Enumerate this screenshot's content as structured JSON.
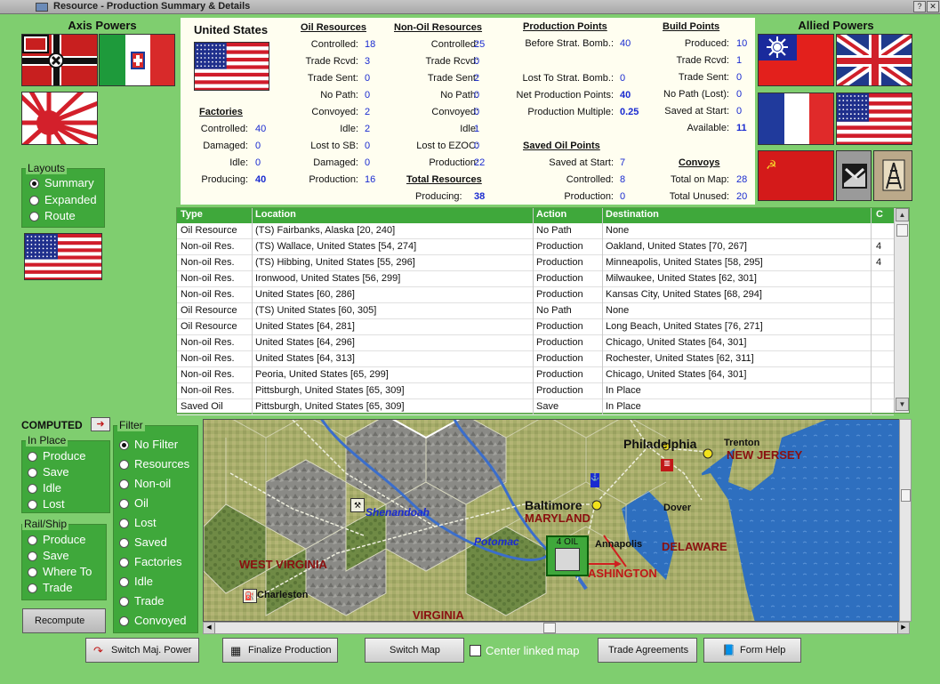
{
  "window": {
    "title": "Resource - Production Summary & Details"
  },
  "axis": {
    "title": "Axis Powers"
  },
  "allied": {
    "title": "Allied Powers"
  },
  "layouts": {
    "label": "Layouts",
    "options": [
      "Summary",
      "Expanded",
      "Route"
    ],
    "selected": "Summary"
  },
  "summary": {
    "country": "United States",
    "factories": {
      "heading": "Factories",
      "rows": [
        {
          "label": "Controlled:",
          "value": "40"
        },
        {
          "label": "Damaged:",
          "value": "0"
        },
        {
          "label": "Idle:",
          "value": "0"
        },
        {
          "label": "Producing:",
          "value": "40"
        }
      ]
    },
    "oil": {
      "heading": "Oil Resources",
      "rows": [
        {
          "label": "Controlled:",
          "value": "18"
        },
        {
          "label": "Trade Rcvd:",
          "value": "3"
        },
        {
          "label": "Trade Sent:",
          "value": "0"
        },
        {
          "label": "No Path:",
          "value": "0"
        },
        {
          "label": "Convoyed:",
          "value": "2"
        },
        {
          "label": "Idle:",
          "value": "2"
        },
        {
          "label": "Lost to SB:",
          "value": "0"
        },
        {
          "label": "Damaged:",
          "value": "0"
        },
        {
          "label": "Production:",
          "value": "16"
        }
      ]
    },
    "nonoil": {
      "heading": "Non-Oil Resources",
      "rows": [
        {
          "label": "Controlled:",
          "value": "25"
        },
        {
          "label": "Trade Rcvd:",
          "value": "0"
        },
        {
          "label": "Trade Sent:",
          "value": "2"
        },
        {
          "label": "No Path:",
          "value": "0"
        },
        {
          "label": "Convoyed:",
          "value": "0"
        },
        {
          "label": "Idle:",
          "value": "1"
        },
        {
          "label": "Lost to EZOC:",
          "value": "0"
        },
        {
          "label": "Production:",
          "value": "22"
        }
      ]
    },
    "total": {
      "heading": "Total Resources",
      "label": "Producing:",
      "value": "38"
    },
    "pp": {
      "heading": "Production Points",
      "rows": [
        {
          "label": "Before Strat. Bomb.:",
          "value": "40"
        },
        {
          "label": "Lost To Strat. Bomb.:",
          "value": "0"
        },
        {
          "label": "Net Production Points:",
          "value": "40"
        },
        {
          "label": "Production Multiple:",
          "value": "0.25"
        }
      ]
    },
    "saved_oil": {
      "heading": "Saved Oil Points",
      "rows": [
        {
          "label": "Saved at Start:",
          "value": "7"
        },
        {
          "label": "Controlled:",
          "value": "8"
        },
        {
          "label": "Production:",
          "value": "0"
        }
      ]
    },
    "bp": {
      "heading": "Build Points",
      "rows": [
        {
          "label": "Produced:",
          "value": "10"
        },
        {
          "label": "Trade Rcvd:",
          "value": "1"
        },
        {
          "label": "Trade Sent:",
          "value": "0"
        },
        {
          "label": "No Path (Lost):",
          "value": "0"
        },
        {
          "label": "Saved at Start:",
          "value": "0"
        },
        {
          "label": "Available:",
          "value": "11"
        }
      ]
    },
    "convoys": {
      "heading": "Convoys",
      "rows": [
        {
          "label": "Total on Map:",
          "value": "28"
        },
        {
          "label": "Total Unused:",
          "value": "20"
        }
      ]
    }
  },
  "table": {
    "headers": [
      "Type",
      "Location",
      "Action",
      "Destination",
      "C"
    ],
    "rows": [
      [
        "Oil Resource",
        "(TS) Fairbanks, Alaska [20, 240]",
        "No Path",
        "None",
        ""
      ],
      [
        "Non-oil Res.",
        "(TS) Wallace, United States [54, 274]",
        "Production",
        "Oakland, United States [70, 267]",
        "4"
      ],
      [
        "Non-oil Res.",
        "(TS) Hibbing, United States [55, 296]",
        "Production",
        "Minneapolis, United States [58, 295]",
        "4"
      ],
      [
        "Non-oil Res.",
        "Ironwood, United States [56, 299]",
        "Production",
        "Milwaukee, United States [62, 301]",
        ""
      ],
      [
        "Non-oil Res.",
        "United States [60, 286]",
        "Production",
        "Kansas City, United States [68, 294]",
        ""
      ],
      [
        "Oil Resource",
        "(TS) United States [60, 305]",
        "No Path",
        "None",
        ""
      ],
      [
        "Oil Resource",
        "United States [64, 281]",
        "Production",
        "Long Beach, United States [76, 271]",
        ""
      ],
      [
        "Non-oil Res.",
        "United States [64, 296]",
        "Production",
        "Chicago, United States [64, 301]",
        ""
      ],
      [
        "Non-oil Res.",
        "United States [64, 313]",
        "Production",
        "Rochester, United States [62, 311]",
        ""
      ],
      [
        "Non-oil Res.",
        "Peoria, United States [65, 299]",
        "Production",
        "Chicago, United States [64, 301]",
        ""
      ],
      [
        "Non-oil Res.",
        "Pittsburgh, United States [65, 309]",
        "Production",
        "In Place",
        ""
      ],
      [
        "Saved Oil",
        "Pittsburgh, United States [65, 309]",
        "Save",
        "In Place",
        ""
      ]
    ]
  },
  "computed": {
    "label": "COMPUTED"
  },
  "in_place": {
    "label": "In Place",
    "options": [
      "Produce",
      "Save",
      "Idle",
      "Lost"
    ]
  },
  "rail_ship": {
    "label": "Rail/Ship",
    "options": [
      "Produce",
      "Save",
      "Where To",
      "Trade"
    ]
  },
  "filter": {
    "label": "Filter",
    "options": [
      "No Filter",
      "Resources",
      "Non-oil",
      "Oil",
      "Lost",
      "Saved",
      "Factories",
      "Idle",
      "Trade",
      "Convoyed"
    ],
    "selected": "No Filter"
  },
  "buttons": {
    "recompute": "Recompute",
    "switch_major": "Switch Maj. Power",
    "finalize": "Finalize Production",
    "switch_map": "Switch Map",
    "center_linked": "Center linked map",
    "trade": "Trade Agreements",
    "form_help": "Form Help"
  },
  "map": {
    "labels": {
      "philadelphia": "Philadelphia",
      "trenton": "Trenton",
      "new_jersey": "NEW JERSEY",
      "baltimore": "Baltimore",
      "maryland": "MARYLAND",
      "dover": "Dover",
      "shenandoah": "Shenandoah",
      "potomac": "Potomac",
      "annapolis": "Annapolis",
      "delaware": "DELAWARE",
      "west_virginia": "WEST VIRGINIA",
      "washington": "ASHINGTON",
      "charleston": "Charleston",
      "virginia": "VIRGINIA",
      "oil_counter": "4 OIL"
    }
  },
  "colors": {
    "panel_green": "#7fce6f",
    "header_green": "#3fa83b",
    "value_blue": "#1a2bd0"
  }
}
